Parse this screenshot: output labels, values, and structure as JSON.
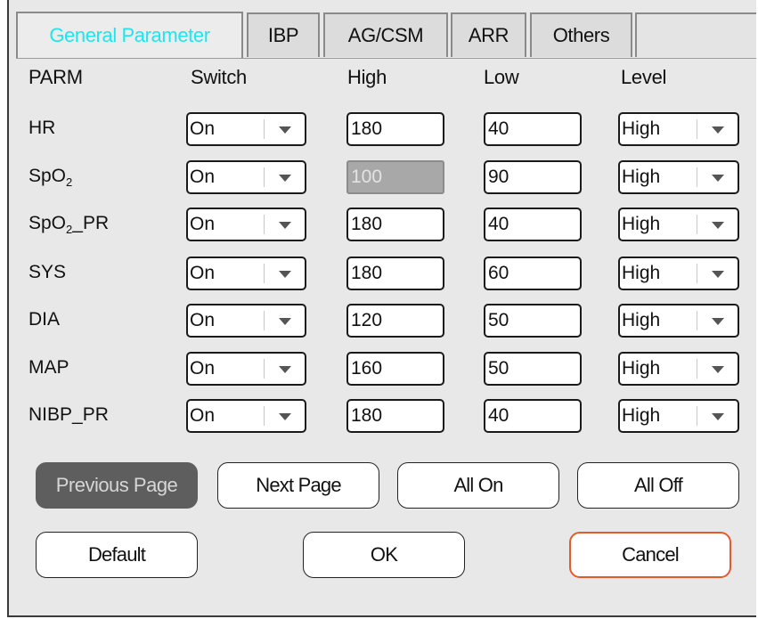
{
  "tabs": [
    "General Parameter",
    "IBP",
    "AG/CSM",
    "ARR",
    "Others"
  ],
  "headers": {
    "parm": "PARM",
    "switch": "Switch",
    "high": "High",
    "low": "Low",
    "level": "Level"
  },
  "rows": [
    {
      "name": "HR",
      "switch": "On",
      "high": "180",
      "low": "40",
      "level": "High"
    },
    {
      "name": "SpO",
      "name_sub": "2",
      "switch": "On",
      "high": "100",
      "low": "90",
      "level": "High",
      "high_disabled": true
    },
    {
      "name": "SpO",
      "name_sub": "2",
      "name_suffix": "_PR",
      "switch": "On",
      "high": "180",
      "low": "40",
      "level": "High"
    },
    {
      "name": "SYS",
      "switch": "On",
      "high": "180",
      "low": "60",
      "level": "High"
    },
    {
      "name": "DIA",
      "switch": "On",
      "high": "120",
      "low": "50",
      "level": "High"
    },
    {
      "name": "MAP",
      "switch": "On",
      "high": "160",
      "low": "50",
      "level": "High"
    },
    {
      "name": "NIBP_PR",
      "switch": "On",
      "high": "180",
      "low": "40",
      "level": "High"
    }
  ],
  "buttons": {
    "previous": "Previous Page",
    "next": "Next Page",
    "all_on": "All On",
    "all_off": "All Off",
    "default": "Default",
    "ok": "OK",
    "cancel": "Cancel"
  },
  "colors": {
    "active_tab_text": "#1ee6ee",
    "cancel_border": "#e55a2a",
    "disabled_button": "#5e5e5e"
  }
}
